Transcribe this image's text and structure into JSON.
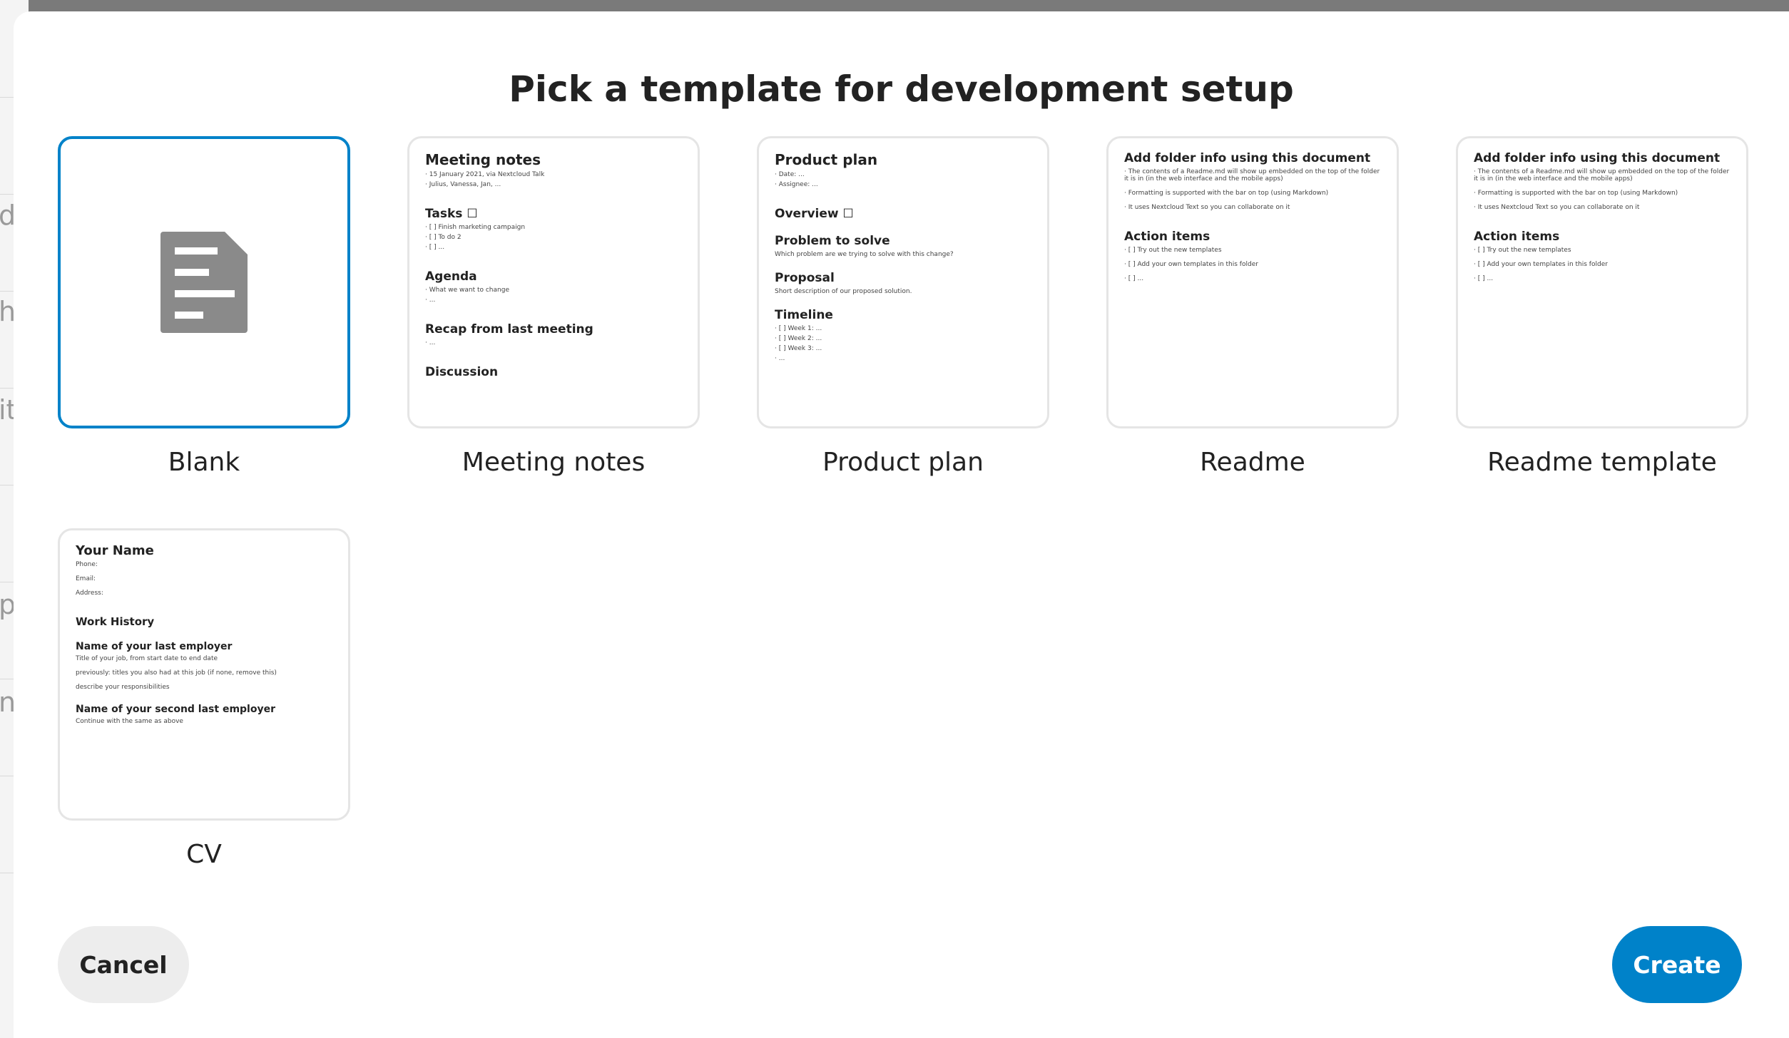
{
  "dialog": {
    "title": "Pick a template for development setup"
  },
  "background": {
    "row_letters": [
      "d",
      "h",
      "it",
      "p",
      "n"
    ]
  },
  "templates": [
    {
      "label": "Blank",
      "selected": true,
      "icon": "document-icon"
    },
    {
      "label": "Meeting notes",
      "preview": {
        "heading": "Meeting notes",
        "lines_1": [
          "· 15 January 2021, via Nextcloud Talk",
          "· Julius, Vanessa, Jan, ..."
        ],
        "tasks_heading": "Tasks ☐",
        "tasks": [
          "· [ ] Finish marketing campaign",
          "· [ ] To do 2",
          "· [ ] ..."
        ],
        "agenda_heading": "Agenda",
        "agenda": [
          "· What we want to change",
          "· ..."
        ],
        "recap_heading": "Recap from last meeting",
        "recap": [
          "· ..."
        ],
        "discussion_heading": "Discussion"
      }
    },
    {
      "label": "Product plan",
      "preview": {
        "heading": "Product plan",
        "lines_1": [
          "· Date: ...",
          "· Assignee: ..."
        ],
        "overview_heading": "Overview ☐",
        "problem_heading": "Problem to solve",
        "problem": "Which problem are we trying to solve with this change?",
        "proposal_heading": "Proposal",
        "proposal": "Short description of our proposed solution.",
        "timeline_heading": "Timeline",
        "timeline": [
          "· [ ] Week 1: ...",
          "· [ ] Week 2: ...",
          "· [ ] Week 3: ...",
          "· ..."
        ]
      }
    },
    {
      "label": "Readme",
      "preview": {
        "heading": "Add folder info using this document",
        "lines_1": [
          "· The contents of a Readme.md will show up embedded on the top of the folder it is in (in the web interface and the mobile apps)",
          "· Formatting is supported with the bar on top (using Markdown)",
          "· It uses Nextcloud Text so you can collaborate on it"
        ],
        "action_heading": "Action items",
        "actions": [
          "· [ ] Try out the new templates",
          "· [ ] Add your own templates in this folder",
          "· [ ] ..."
        ]
      }
    },
    {
      "label": "Readme template",
      "preview": {
        "heading": "Add folder info using this document",
        "lines_1": [
          "· The contents of a Readme.md will show up embedded on the top of the folder it is in (in the web interface and the mobile apps)",
          "· Formatting is supported with the bar on top (using Markdown)",
          "· It uses Nextcloud Text so you can collaborate on it"
        ],
        "action_heading": "Action items",
        "actions": [
          "· [ ] Try out the new templates",
          "· [ ] Add your own templates in this folder",
          "· [ ] ..."
        ]
      }
    },
    {
      "label": "CV",
      "preview": {
        "heading": "Your Name",
        "contact": [
          "Phone:",
          "Email:",
          "Address:"
        ],
        "history_heading": "Work History",
        "employer1_heading": "Name of your last employer",
        "employer1": [
          "Title of your job, from start date to end date",
          "previously: titles you also had at this job (if none, remove this)",
          "describe your responsibilities"
        ],
        "employer2_heading": "Name of your second last employer",
        "employer2": [
          "Continue with the same as above"
        ]
      }
    }
  ],
  "actions": {
    "cancel_label": "Cancel",
    "create_label": "Create"
  },
  "colors": {
    "accent": "#0082c9",
    "backdrop": "#7a7a7a"
  }
}
